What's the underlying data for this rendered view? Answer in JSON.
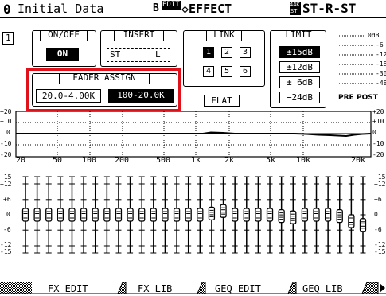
{
  "header": {
    "scene_number": "0",
    "scene_title": "Initial Data",
    "edit_badge_prefix": "B",
    "edit_badge": "EDIT",
    "effect_label": "◇EFFECT",
    "sample_rate_top": "44K",
    "sample_rate_bottom": "ST",
    "channel_label": "ST-R-ST"
  },
  "channel_number": "1",
  "on_off": {
    "title": "ON/OFF",
    "value": "ON"
  },
  "insert": {
    "title": "INSERT",
    "value_left": "ST",
    "value_right": "L"
  },
  "link": {
    "title": "LINK",
    "buttons": [
      "1",
      "2",
      "3",
      "4",
      "5",
      "6"
    ],
    "active_index": 0
  },
  "limit": {
    "title": "LIMIT",
    "buttons": [
      "±15dB",
      "±12dB",
      "± 6dB",
      "−24dB"
    ],
    "active_index": 0
  },
  "meter": {
    "labels": [
      "0dB",
      "-6",
      "-12",
      "-18",
      "-30",
      "-48"
    ],
    "pre_label": "PRE",
    "post_label": "POST"
  },
  "fader_assign": {
    "title": "FADER ASSIGN",
    "options": [
      "20.0-4.00K",
      "100-20.0K"
    ],
    "active_index": 1
  },
  "flat_button": "FLAT",
  "graph": {
    "y_labels_left": [
      "+20",
      "+10",
      "0",
      "-10",
      "-20"
    ],
    "y_labels_right": [
      "+20",
      "+10",
      "0",
      "-10",
      "-20"
    ],
    "x_labels": [
      "20",
      "50",
      "100",
      "200",
      "500",
      "1k",
      "2k",
      "5k",
      "10k",
      "20k"
    ]
  },
  "fader_scale": {
    "left": [
      "+15",
      "+12",
      "+6",
      "0",
      "-6",
      "-12",
      "-15"
    ],
    "right": [
      "+15",
      "+12",
      "+6",
      "0",
      "-6",
      "-12",
      "-15"
    ]
  },
  "fader_gains": [
    0,
    0,
    0,
    0,
    0,
    0,
    0,
    0,
    0,
    0,
    0,
    0,
    0,
    0,
    0,
    0,
    0.5,
    1.5,
    0,
    0,
    0,
    0,
    -0.5,
    -1,
    0,
    0,
    0,
    -0.5,
    -2.5,
    -4
  ],
  "tabs": [
    "FX EDIT",
    "FX LIB",
    "GEQ EDIT",
    "GEQ LIB"
  ],
  "active_tab": 2
}
